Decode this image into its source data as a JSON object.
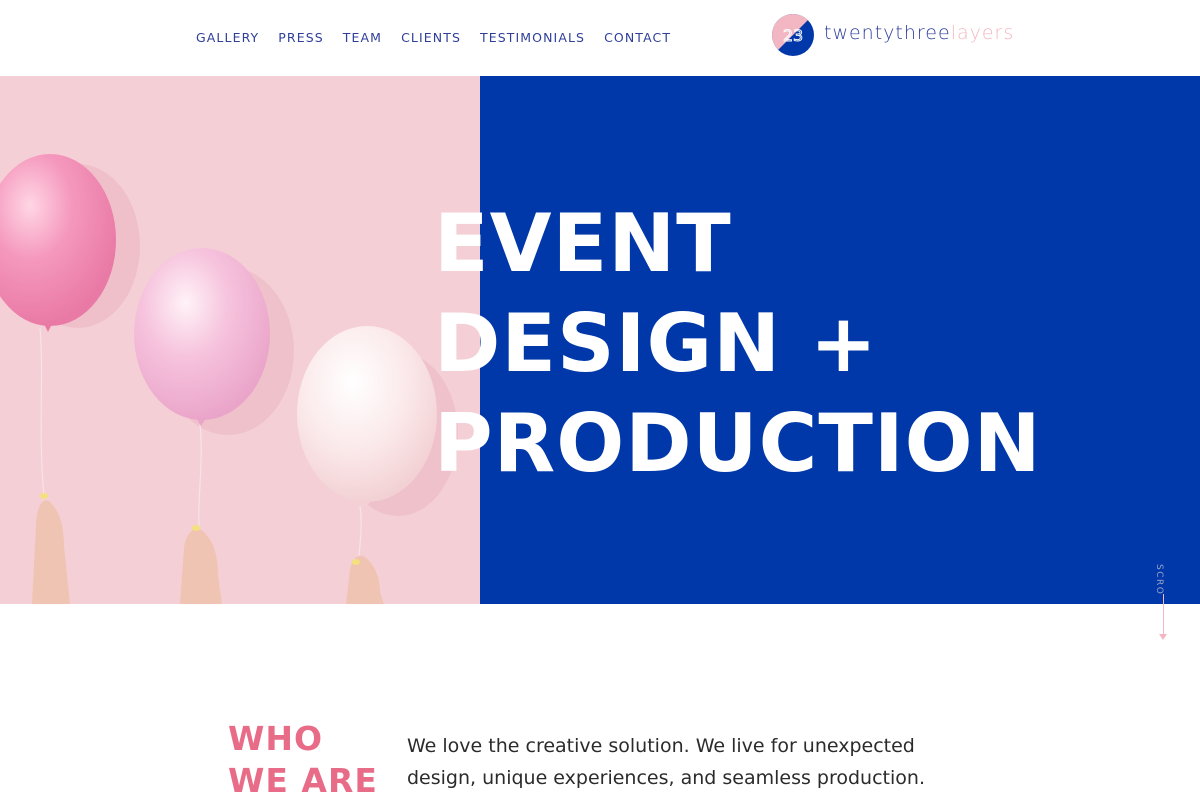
{
  "nav": {
    "items": [
      {
        "label": "GALLERY"
      },
      {
        "label": "PRESS"
      },
      {
        "label": "TEAM"
      },
      {
        "label": "CLIENTS"
      },
      {
        "label": "TESTIMONIALS"
      },
      {
        "label": "CONTACT"
      }
    ]
  },
  "logo": {
    "mark_text": "23",
    "word_part1": "twentythree",
    "word_part2": "layers",
    "mark_colors": [
      "#f2b7c3",
      "#0138a9"
    ]
  },
  "hero": {
    "title_lines": [
      "EVENT",
      "DESIGN +",
      "PRODUCTION"
    ],
    "left_color": "#f5cfd6",
    "right_color": "#0138a9",
    "scroll_label": "SCRO"
  },
  "who": {
    "heading_lines": [
      "WHO",
      "WE ARE"
    ],
    "text": "We love the creative solution. We live for unexpected design, unique experiences, and seamless production."
  },
  "colors": {
    "nav": "#2f3f9a",
    "accent_pink": "#e86c88",
    "blue": "#0138a9"
  },
  "icons": [
    "logo-mark-icon",
    "scroll-arrow-icon"
  ]
}
